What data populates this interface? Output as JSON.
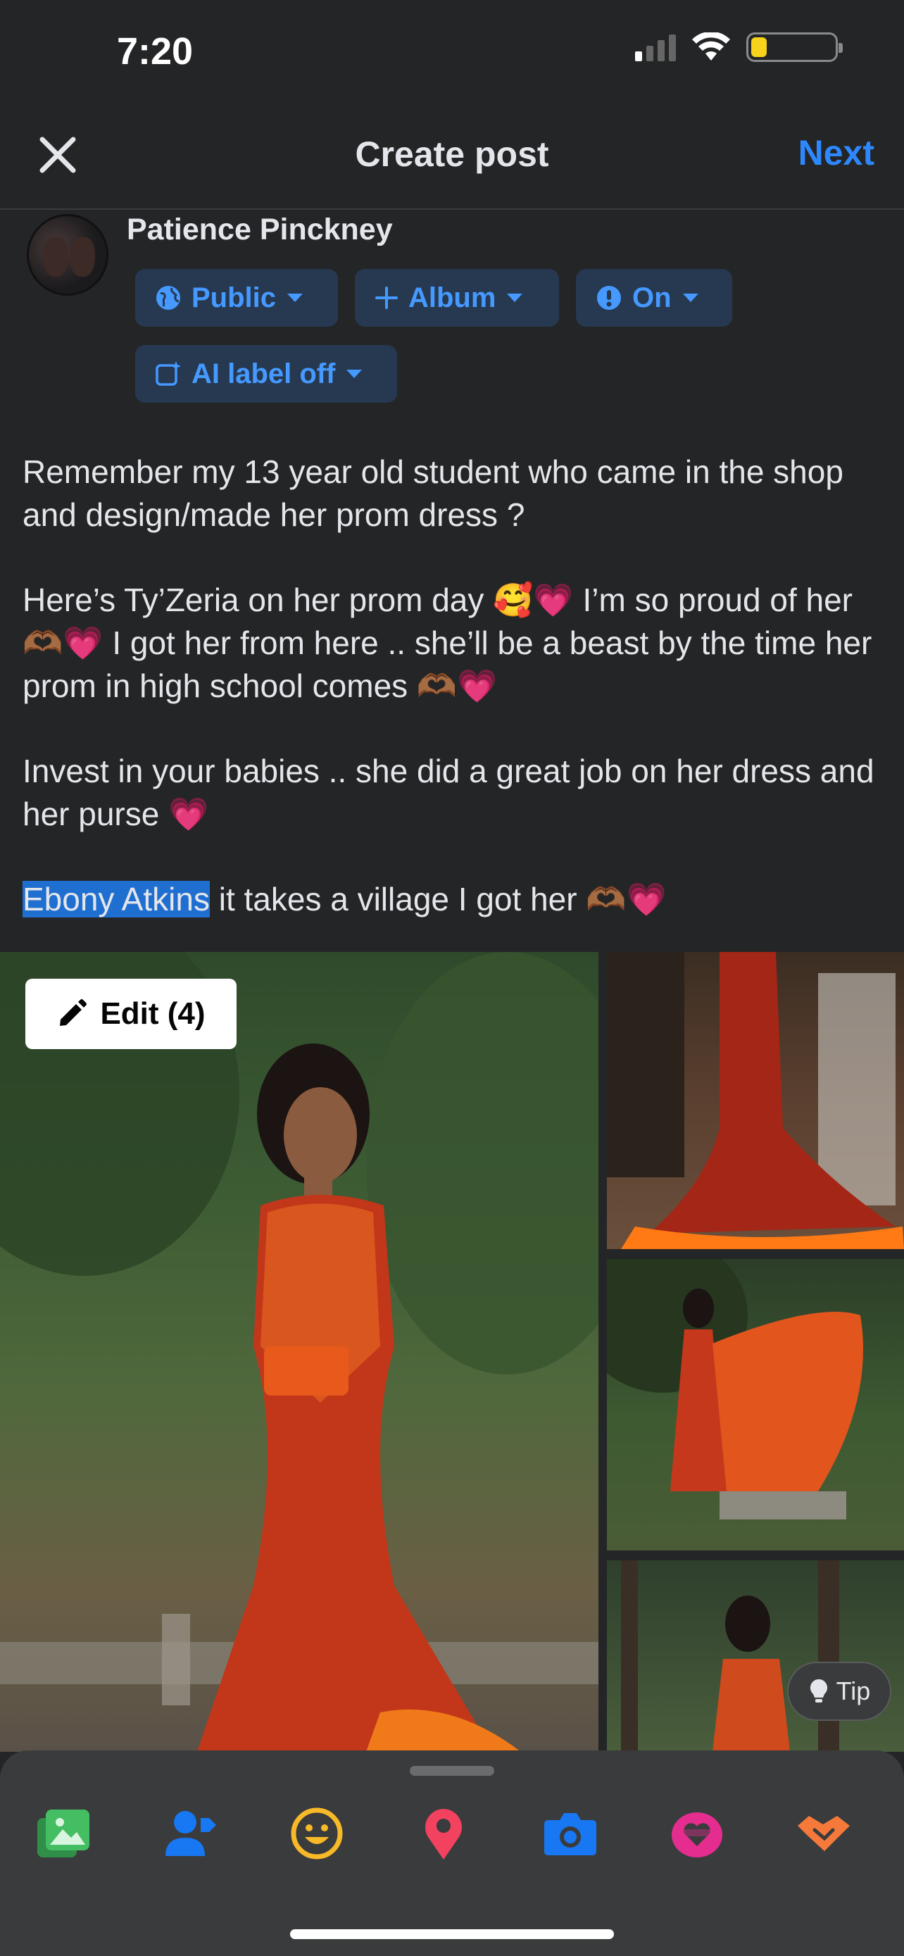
{
  "status_bar": {
    "time": "7:20",
    "battery_level": 0.2
  },
  "header": {
    "title": "Create post",
    "next_label": "Next"
  },
  "profile": {
    "name": "Patience Pinckney"
  },
  "chips": {
    "audience": "Public",
    "album": "Album",
    "on": "On",
    "ai_label": "AI label off"
  },
  "post": {
    "paragraph1": "Remember my 13 year old student who came in the shop and design/made her prom dress ?",
    "paragraph2": "Here’s Ty’Zeria on her prom day 🥰💗 I’m so proud of her 🫶🏾💗 I got her from here .. she’ll be a beast by the time her prom in high school comes 🫶🏾💗",
    "paragraph3": "Invest in your babies .. she did a great job on her dress and her purse 💗",
    "mention": "Ebony Atkins",
    "paragraph4_rest": " it takes a village I got her 🫶🏾💗"
  },
  "media": {
    "edit_label": "Edit (4)",
    "tip_label": "Tip"
  },
  "toolbar": {
    "items": [
      "photo-video",
      "tag-people",
      "feeling-activity",
      "check-in",
      "camera",
      "fundraiser",
      "partnership"
    ],
    "colors": {
      "photo": "#45bd62",
      "tag": "#1877f2",
      "feeling": "#f7b928",
      "checkin": "#f3425f",
      "camera": "#1877f2",
      "fundraiser": "#e42d8f",
      "partnership": "#f5793a"
    }
  },
  "colors": {
    "background": "#242526",
    "accent": "#2d88ff",
    "chip_bg": "#263951",
    "mention_bg": "#1f6fd1"
  }
}
